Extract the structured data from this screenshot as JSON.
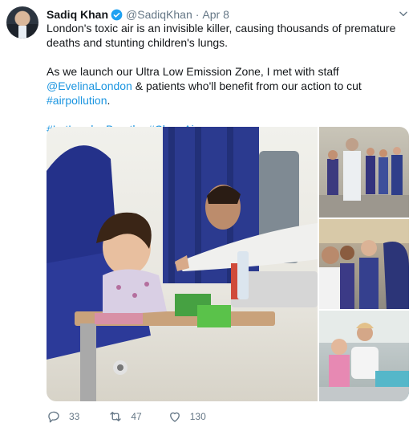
{
  "author": {
    "name": "Sadiq Khan",
    "handle": "@SadiqKhan",
    "separator": "·",
    "date": "Apr 8",
    "verified": true
  },
  "tweet": {
    "line1": "London's toxic air is an invisible killer, causing thousands of premature deaths and stunting children's lungs.",
    "p2_prefix": "As we launch our Ultra Low Emission Zone, I met with staff ",
    "p2_mention": "@EvelinaLondon",
    "p2_middle": " & patients who'll benefit from our action to cut ",
    "p2_hashtag": "#airpollution",
    "p2_suffix": ".",
    "hashtag1": "#LetLondonBreathe",
    "hashtag2": "#CleanAir"
  },
  "actions": {
    "replies": "33",
    "retweets": "47",
    "likes": "130"
  },
  "colors": {
    "link": "#1b95e0",
    "verified": "#1da1f2",
    "muted": "#657786"
  },
  "icons": [
    "verified-badge-icon",
    "chevron-down-icon",
    "reply-icon",
    "retweet-icon",
    "like-icon"
  ]
}
